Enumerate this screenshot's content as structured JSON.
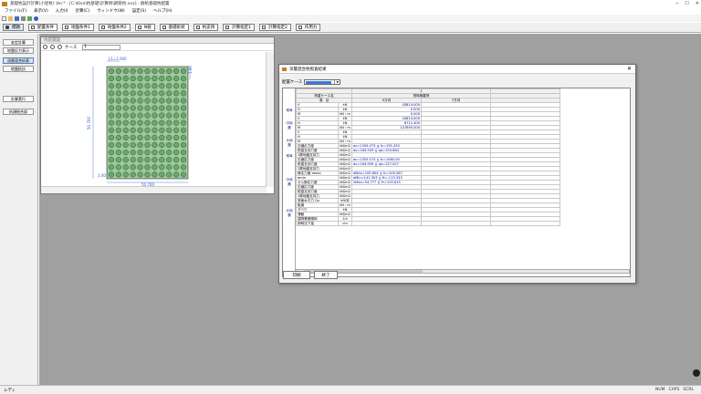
{
  "window": {
    "title": "基礎杭設計計算(小径杭) Ver.* - [C:\\Kiso\\杭基礎\\計算例\\鋼管杭.xxx] - 群杭基礎杭配置",
    "min": "─",
    "max": "☐",
    "close": "✕"
  },
  "menu": [
    "ファイル(F)",
    "表示(V)",
    "入力(I)",
    "計算(C)",
    "ウィンドウ(W)",
    "設定(S)",
    "ヘルプ(H)"
  ],
  "tabs": [
    {
      "label": "標題",
      "active": true
    },
    {
      "label": "配置条件",
      "active": false
    },
    {
      "label": "地盤条件1",
      "active": false
    },
    {
      "label": "地盤条件2",
      "active": false
    },
    {
      "label": "N値",
      "active": false
    },
    {
      "label": "基礎形状",
      "active": false
    },
    {
      "label": "杭支持",
      "active": false
    },
    {
      "label": "計算指定1",
      "active": false
    },
    {
      "label": "計算指定2",
      "active": false
    },
    {
      "label": "作用力",
      "active": false
    }
  ],
  "sidebar": {
    "b1": "安定計算",
    "b2": "地盤反力表示",
    "b3": "深層混合杭表",
    "b4": "地盤抵抗",
    "b5": "計算実行",
    "b6": "杭頭結合部"
  },
  "child": {
    "title": "杭配置図",
    "case_label": "ケース",
    "case_value": "1",
    "dims": {
      "top": "L1=1.000",
      "left": "50.700",
      "bottom": "50.700",
      "right": "1.00",
      "corner": "1.00"
    }
  },
  "dialog": {
    "title": "深層混合杭照査結果",
    "case_label": "配置ケース",
    "print_btn": "印刷",
    "close_btn": "終了"
  },
  "table": {
    "col_header_num": "1",
    "case_name_label": "荷重ケース名",
    "item_label": "項　目",
    "case_title": "常時無載荷",
    "x_dir": "X方向",
    "y_dir": "Y方向",
    "rows": [
      {
        "label": "V",
        "unit": "kN",
        "x": "43814.000",
        "y": ""
      },
      {
        "label": "H",
        "unit": "kN",
        "x": "0.000",
        "y": ""
      },
      {
        "label": "M",
        "unit": "kN・m",
        "x": "0.000",
        "y": ""
      },
      {
        "label": "V",
        "unit": "kN",
        "x": "43814.000",
        "y": ""
      },
      {
        "label": "H",
        "unit": "kN",
        "x": "6711.400",
        "y": ""
      },
      {
        "label": "M",
        "unit": "kN・m",
        "x": "137890.000",
        "y": ""
      },
      {
        "label": "V",
        "unit": "kN",
        "x": "",
        "y": ""
      },
      {
        "label": "H",
        "unit": "kN",
        "x": "",
        "y": ""
      },
      {
        "label": "M",
        "unit": "kN・m",
        "x": "",
        "y": ""
      },
      {
        "label": "圧縮応力度",
        "unit": "kN/m2",
        "x": "σc=1305.073 ≦ fc=195.333",
        "y": ""
      },
      {
        "label": "鉛直支持力度",
        "unit": "kN/m2",
        "x": "σv=164.909 ≦ qa=193.864",
        "y": ""
      },
      {
        "label": "2層地盤支持力",
        "unit": "kN/m2",
        "x": "",
        "y": ""
      },
      {
        "label": "圧縮応力度",
        "unit": "kN/m2",
        "x": "σc=1305.073 ≦ fc=1060.00",
        "y": ""
      },
      {
        "label": "鉛直支持力度",
        "unit": "kN/m2",
        "x": "σv=164.909 ≦ qa=127.027",
        "y": ""
      },
      {
        "label": "2層地盤支持力",
        "unit": "kN/m2",
        "x": "",
        "y": ""
      },
      {
        "label": "縁応力度 σmax",
        "unit": "kN/m2",
        "x": "σMax=105.804 ≦ fc=100.087",
        "y": ""
      },
      {
        "label": "σmin",
        "unit": "kN/m2",
        "x": "σMin=141.303 ≦ ft=-113.333",
        "y": ""
      },
      {
        "label": "せん断応力度",
        "unit": "kN/m2",
        "x": "τMax=54.777 ≦ fτ=105.815",
        "y": ""
      },
      {
        "label": "圧縮応力度",
        "unit": "kN/m2",
        "x": "",
        "y": ""
      },
      {
        "label": "鉛直支持力度",
        "unit": "kN/m2",
        "x": "",
        "y": ""
      },
      {
        "label": "2層地盤支持力",
        "unit": "kN/m2",
        "x": "",
        "y": ""
      },
      {
        "label": "底面水平力 Qu",
        "unit": "kN/本",
        "x": "",
        "y": ""
      },
      {
        "label": "転倒",
        "unit": "kN・m",
        "x": "",
        "y": ""
      },
      {
        "label": "すべり",
        "unit": "kN",
        "x": "",
        "y": ""
      },
      {
        "label": "滑動",
        "unit": "kN/m2",
        "x": "",
        "y": ""
      },
      {
        "label": "建物基礎傾斜",
        "unit": "1/n",
        "x": "",
        "y": ""
      },
      {
        "label": "即時沈下量",
        "unit": "cm",
        "x": "",
        "y": ""
      }
    ]
  },
  "left_groups": [
    "常時",
    "中地震",
    "大地震",
    "常時",
    "中地震",
    "大地震"
  ],
  "status": {
    "ready": "レディ",
    "num": "NUM",
    "caps": "CAPS",
    "scrl": "SCRL"
  }
}
